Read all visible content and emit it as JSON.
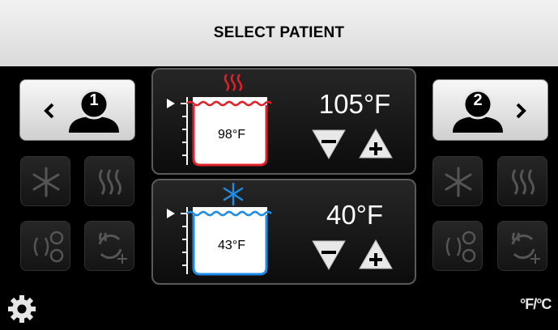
{
  "header": {
    "title": "SELECT PATIENT"
  },
  "patients": {
    "left": {
      "number": "1",
      "arrow": "chevron-left"
    },
    "right": {
      "number": "2",
      "arrow": "chevron-right"
    }
  },
  "zones": {
    "heating": {
      "setpoint": "105°F",
      "water_temp": "98°F",
      "mode_icon": "heat-icon",
      "color": "#e0202a"
    },
    "cooling": {
      "setpoint": "40°F",
      "water_temp": "43°F",
      "mode_icon": "snowflake-icon",
      "color": "#1e8ce6"
    }
  },
  "footer": {
    "units_label": "°F/°C"
  }
}
